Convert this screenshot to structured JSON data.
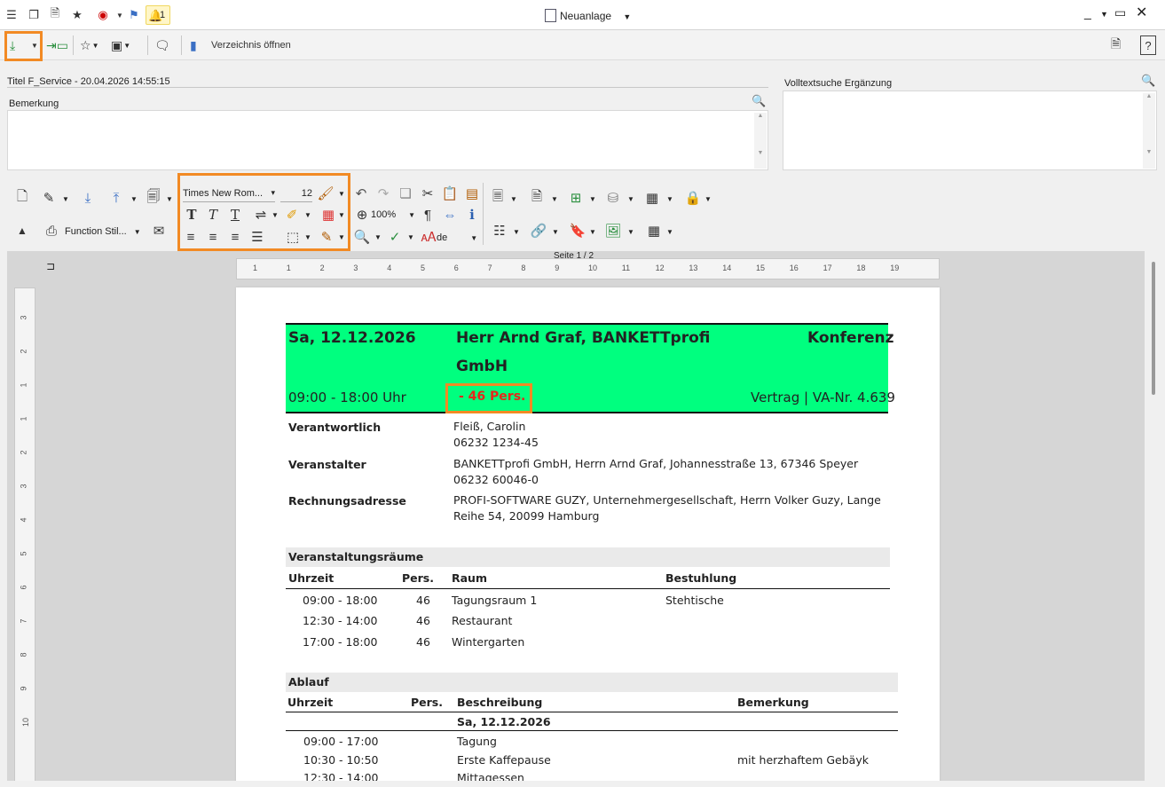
{
  "window": {
    "title": "Neuanlage",
    "bell_count": "1"
  },
  "toolbar2": {
    "open_directory_label": "Verzeichnis öffnen"
  },
  "form": {
    "title_label": "Titel",
    "title_value": "F_Service - 20.04.2026 14:55:15",
    "remark_label": "Bemerkung",
    "fulltext_label": "Volltextsuche Ergänzung"
  },
  "writer_toolbar": {
    "font_name": "Times New Rom...",
    "font_size": "12",
    "zoom": "100%",
    "language": "de",
    "style_name": "Function Stil..."
  },
  "ruler": {
    "page_indicator": "Seite 1 / 2",
    "h_ticks": [
      "1",
      "1",
      "2",
      "3",
      "4",
      "5",
      "6",
      "7",
      "8",
      "9",
      "10",
      "11",
      "12",
      "13",
      "14",
      "15",
      "16",
      "17",
      "18",
      "19"
    ],
    "v_ticks": [
      "3",
      "2",
      "1",
      "1",
      "2",
      "3",
      "4",
      "5",
      "6",
      "7",
      "8",
      "9",
      "10"
    ]
  },
  "document": {
    "date": "Sa, 12.12.2026",
    "customer": "Herr Arnd Graf, BANKETTprofi",
    "customer_line2": "GmbH",
    "event_type": "Konferenz",
    "time": "09:00 - 18:00 Uhr",
    "persons": "- 46 Pers.",
    "contract": "Vertrag | VA-Nr. 4.639",
    "info_rows": [
      {
        "label": "Verantwortlich",
        "line1": "Fleiß, Carolin",
        "line2": "06232 1234-45"
      },
      {
        "label": "Veranstalter",
        "line1": "BANKETTprofi GmbH, Herrn Arnd Graf, Johannesstraße 13, 67346 Speyer",
        "line2": "06232 60046-0"
      },
      {
        "label": "Rechnungsadresse",
        "line1": "PROFI-SOFTWARE GUZY, Unternehmergesellschaft, Herrn Volker Guzy, Lange",
        "line2": "Reihe 54, 20099 Hamburg"
      }
    ],
    "rooms": {
      "title": "Veranstaltungsräume",
      "headers": [
        "Uhrzeit",
        "Pers.",
        "Raum",
        "Bestuhlung"
      ],
      "rows": [
        [
          "09:00 - 18:00",
          "46",
          "Tagungsraum 1",
          "Stehtische"
        ],
        [
          "12:30 - 14:00",
          "46",
          "Restaurant",
          ""
        ],
        [
          "17:00 - 18:00",
          "46",
          "Wintergarten",
          ""
        ]
      ]
    },
    "schedule": {
      "title": "Ablauf",
      "headers": [
        "Uhrzeit",
        "Pers.",
        "Beschreibung",
        "Bemerkung"
      ],
      "date_row": "Sa, 12.12.2026",
      "rows": [
        [
          "09:00 - 17:00",
          "",
          "Tagung",
          ""
        ],
        [
          "10:30 - 10:50",
          "",
          "Erste Kaffepause",
          "mit herzhaftem Gebäyk"
        ],
        [
          "12:30 - 14:00",
          "",
          "Mittagessen",
          ""
        ]
      ]
    }
  },
  "colors": {
    "accent_orange": "#f28a24",
    "header_green": "#00ff7f",
    "persons_red": "#e8261a"
  }
}
